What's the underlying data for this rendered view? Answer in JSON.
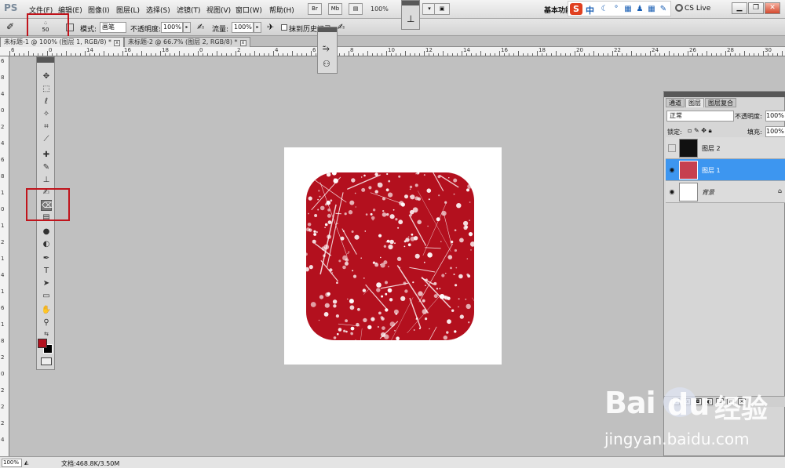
{
  "menubar": {
    "logo": "PS",
    "items": [
      "文件(F)",
      "编辑(E)",
      "图像(I)",
      "图层(L)",
      "选择(S)",
      "滤镜(T)",
      "视图(V)",
      "窗口(W)",
      "帮助(H)"
    ],
    "btn_br": "Br",
    "btn_mb": "Mb",
    "zoom": "100%",
    "workspace": "基本功能",
    "ime_logo": "S",
    "ime_lang": "中",
    "cs_live": "CS Live"
  },
  "options": {
    "brush_size": "50",
    "mode_label": "模式:",
    "mode_value": "画笔",
    "opacity_label": "不透明度:",
    "opacity_value": "100%",
    "flow_label": "流量:",
    "flow_value": "100%",
    "history_label": "抹到历史记录"
  },
  "tabs": [
    {
      "label": "未标题-1 @ 100% (图层 1, RGB/8) *",
      "close": "x"
    },
    {
      "label": "未标题-2 @ 66.7% (图层 2, RGB/8) *",
      "close": "x"
    }
  ],
  "ruler": {
    "h": [
      "6",
      "0",
      "14",
      "16",
      "18",
      "0",
      "2",
      "4",
      "6",
      "8",
      "10",
      "12",
      "14",
      "16",
      "18",
      "20",
      "22",
      "24",
      "26",
      "28",
      "30"
    ],
    "v": [
      "6",
      "8",
      "4",
      "0",
      "2",
      "4",
      "6",
      "8",
      "1",
      "0",
      "1",
      "2",
      "1",
      "4",
      "1",
      "6",
      "1",
      "8",
      "2",
      "0",
      "2",
      "2",
      "2",
      "4"
    ]
  },
  "tool_icons": [
    "move-icon",
    "marquee-icon",
    "lasso-icon",
    "quick-select-icon",
    "crop-icon",
    "eyedropper-icon",
    "healing-brush-icon",
    "brush-icon",
    "clone-stamp-icon",
    "history-brush-icon",
    "eraser-icon",
    "gradient-icon",
    "blur-icon",
    "dodge-icon",
    "pen-icon",
    "type-icon",
    "path-select-icon",
    "shape-icon",
    "hand-icon",
    "zoom-icon"
  ],
  "colors": {
    "foreground": "#b3101e",
    "background": "#000000",
    "artwork": "#b3101e",
    "layer_selected": "#3d96f0",
    "highlight": "#c0141c"
  },
  "layers_panel": {
    "tabs": [
      "通道",
      "图层",
      "图层复合"
    ],
    "blend_mode": "正常",
    "opacity_label": "不透明度:",
    "opacity_value": "100%",
    "lock_label": "锁定:",
    "fill_label": "填充:",
    "fill_value": "100%",
    "layers": [
      {
        "name": "图层 2",
        "visible": false,
        "selected": false
      },
      {
        "name": "图层 1",
        "visible": true,
        "selected": true
      },
      {
        "name": "背景",
        "visible": true,
        "selected": false
      }
    ]
  },
  "status": {
    "zoom": "100%",
    "doc_info": "文档:468.8K/3.50M"
  },
  "watermark": {
    "brand": "Bai",
    "brand2": "du",
    "cn": "经验",
    "url": "jingyan.baidu.com"
  }
}
